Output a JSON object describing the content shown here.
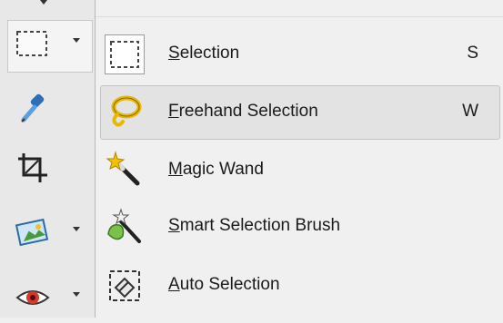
{
  "toolbar": {
    "tools": [
      {
        "name": "selection-tool",
        "icon": "selection-rect-icon",
        "has_dropdown": true,
        "active": true
      },
      {
        "name": "eyedropper-tool",
        "icon": "eyedropper-icon",
        "has_dropdown": false
      },
      {
        "name": "crop-tool",
        "icon": "crop-icon",
        "has_dropdown": false
      },
      {
        "name": "image-tool",
        "icon": "picture-icon",
        "has_dropdown": true
      },
      {
        "name": "red-eye-tool",
        "icon": "eye-icon",
        "has_dropdown": true
      }
    ]
  },
  "menu": {
    "items": [
      {
        "mnemonic": "S",
        "rest": "election",
        "shortcut": "S",
        "icon": "selection-rect-icon"
      },
      {
        "mnemonic": "F",
        "rest": "reehand Selection",
        "shortcut": "W",
        "icon": "lasso-icon",
        "highlighted": true
      },
      {
        "mnemonic": "M",
        "rest": "agic Wand",
        "shortcut": "",
        "icon": "magic-wand-icon"
      },
      {
        "mnemonic": "S",
        "rest": "mart Selection Brush",
        "shortcut": "",
        "icon": "smart-brush-icon"
      },
      {
        "mnemonic": "A",
        "rest": "uto Selection",
        "shortcut": "",
        "icon": "auto-selection-icon"
      }
    ]
  },
  "colors": {
    "menu_bg": "#f0f0f0",
    "hover_bg": "#e3e3e3",
    "text": "#1b1b1b",
    "lasso_yellow": "#e6b800",
    "eye_red": "#d23a2a"
  }
}
